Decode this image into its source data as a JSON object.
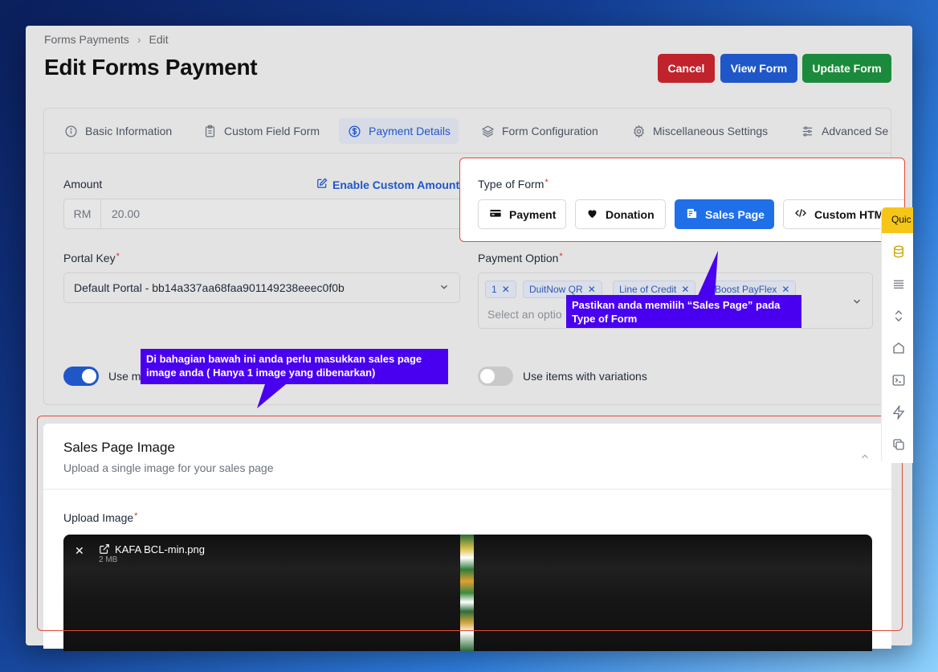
{
  "breadcrumb": {
    "root": "Forms Payments",
    "current": "Edit"
  },
  "page_title": "Edit Forms Payment",
  "header_buttons": {
    "cancel": "Cancel",
    "view": "View Form",
    "update": "Update Form"
  },
  "colors": {
    "cancel": "#c0232c",
    "view": "#1f57c9",
    "update": "#1c8a3c",
    "annotation": "#4a00f0",
    "highlight_border": "#e24a3b",
    "active_type": "#1f6fe8"
  },
  "tabs": [
    {
      "label": "Basic Information",
      "icon": "info-icon"
    },
    {
      "label": "Custom Field Form",
      "icon": "clipboard-icon"
    },
    {
      "label": "Payment Details",
      "icon": "dollar-circle-icon"
    },
    {
      "label": "Form Configuration",
      "icon": "layers-icon"
    },
    {
      "label": "Miscellaneous Settings",
      "icon": "gear-icon"
    },
    {
      "label": "Advanced Se",
      "icon": "sliders-icon"
    }
  ],
  "amount": {
    "label": "Amount",
    "prefix": "RM",
    "value": "20.00",
    "enable_custom": "Enable Custom Amount"
  },
  "portal_key": {
    "label": "Portal Key",
    "value": "Default Portal - bb14a337aa68faa901149238eeec0f0b"
  },
  "payment_option": {
    "label": "Payment Option",
    "chips": [
      "1",
      "DuitNow QR",
      "Line of Credit",
      "Boost PayFlex"
    ],
    "placeholder": "Select an optio"
  },
  "toggles": {
    "left_label": "Use m",
    "right_label": "Use items with variations"
  },
  "type_of_form": {
    "label": "Type of Form",
    "options": [
      {
        "label": "Payment",
        "icon": "card-icon"
      },
      {
        "label": "Donation",
        "icon": "heart-icon"
      },
      {
        "label": "Sales Page",
        "icon": "receipt-icon"
      },
      {
        "label": "Custom HTM",
        "icon": "code-icon"
      }
    ],
    "selected": "Sales Page"
  },
  "annotations": {
    "sales_page": "Pastikan anda memilih “Sales Page” pada Type of Form",
    "image_upload": "Di bahagian bawah ini anda perlu masukkan sales page image anda ( Hanya 1 image yang dibenarkan)"
  },
  "sales_page_image": {
    "title": "Sales Page Image",
    "subtitle": "Upload a single image for your sales page",
    "upload_label": "Upload Image",
    "file_name": "KAFA BCL-min.png",
    "file_size": "2 MB"
  },
  "side_panel": {
    "quick": "Quic"
  }
}
